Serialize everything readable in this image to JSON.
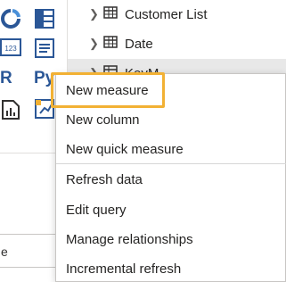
{
  "visualizations": {
    "letter_r": "R",
    "letter_py": "Py",
    "card_text": "123",
    "input_value": "e"
  },
  "fields": [
    {
      "label": "Customer List"
    },
    {
      "label": "Date"
    },
    {
      "label": "KeyM"
    }
  ],
  "context_menu": {
    "items": [
      {
        "label": "New measure"
      },
      {
        "label": "New column"
      },
      {
        "label": "New quick measure"
      },
      {
        "label": "Refresh data"
      },
      {
        "label": "Edit query"
      },
      {
        "label": "Manage relationships"
      },
      {
        "label": "Incremental refresh"
      }
    ]
  },
  "colors": {
    "highlight": "#f2b134",
    "icon_blue": "#2b5797"
  }
}
